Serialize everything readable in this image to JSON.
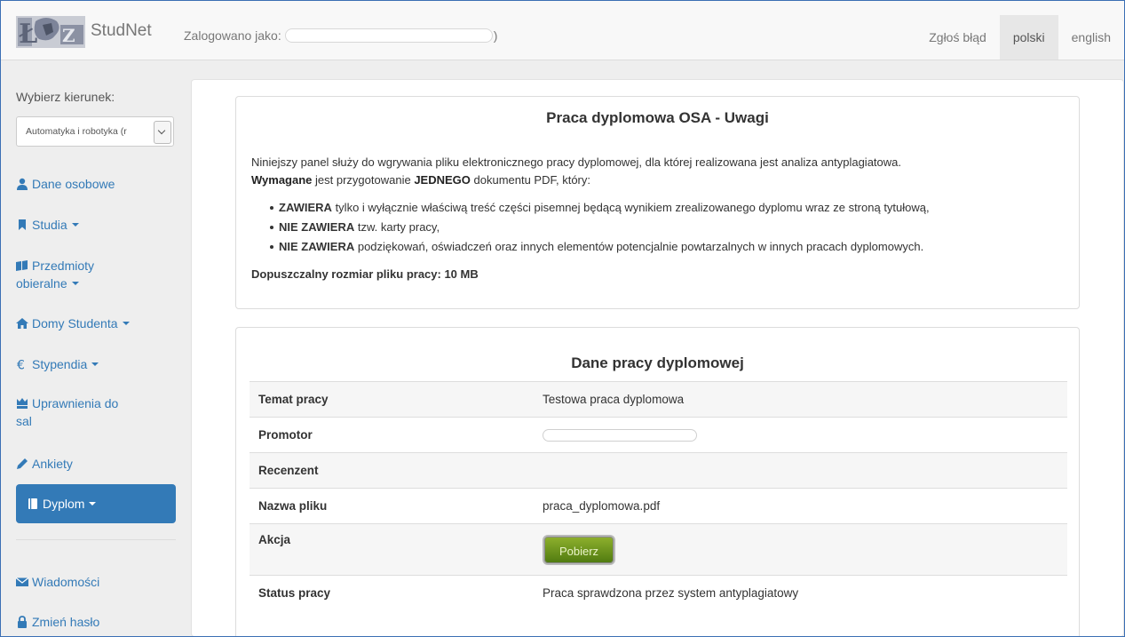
{
  "navbar": {
    "brand": "StudNet",
    "logged_as_label": "Zalogowano jako:",
    "paren": ")",
    "links": [
      "Zgłoś błąd",
      "polski",
      "english"
    ]
  },
  "sidebar": {
    "label": "Wybierz kierunek:",
    "select_value": "Automatyka i robotyka (r",
    "items": [
      {
        "label": "Dane osobowe",
        "icon": "user-icon"
      },
      {
        "label": "Studia",
        "icon": "bookmark-icon"
      },
      {
        "label": "Przedmioty",
        "label2": "obieralne",
        "icon": "book-open-icon"
      },
      {
        "label": "Domy Studenta",
        "icon": "home-icon"
      },
      {
        "label": "Stypendia",
        "icon": "euro-icon"
      },
      {
        "label": "Uprawnienia do",
        "label2": "sal",
        "icon": "throne-icon"
      },
      {
        "label": "Ankiety",
        "icon": "pencil-icon"
      },
      {
        "label": "Dyplom",
        "icon": "book-icon"
      },
      {
        "label": "Wiadomości",
        "icon": "envelope-icon"
      },
      {
        "label": "Zmień hasło",
        "icon": "lock-icon"
      }
    ]
  },
  "notes": {
    "title": "Praca dyplomowa OSA - Uwagi",
    "line1": "Niniejszy panel służy do wgrywania pliku elektronicznego pracy dyplomowej, dla której realizowana jest analiza antyplagiatowa.",
    "line2_b1": "Wymagane",
    "line2_t1": " jest przygotowanie ",
    "line2_b2": "JEDNEGO",
    "line2_t2": " dokumentu PDF, który:",
    "bullets": [
      {
        "bold": "ZAWIERA",
        "text": " tylko i wyłącznie właściwą treść części pisemnej będącą wynikiem zrealizowanego dyplomu wraz ze stroną tytułową,"
      },
      {
        "bold": "NIE ZAWIERA",
        "text": " tzw. karty pracy,"
      },
      {
        "bold": "NIE ZAWIERA",
        "text": " podziękowań, oświadczeń oraz innych elementów potencjalnie powtarzalnych w innych pracach dyplomowych."
      }
    ],
    "max_size": "Dopuszczalny rozmiar pliku pracy: 10 MB"
  },
  "thesis": {
    "title": "Dane pracy dyplomowej",
    "rows": [
      {
        "key": "Temat pracy",
        "value": "Testowa praca dyplomowa"
      },
      {
        "key": "Promotor",
        "value": ""
      },
      {
        "key": "Recenzent",
        "value": ""
      },
      {
        "key": "Nazwa pliku",
        "value": "praca_dyplomowa.pdf"
      },
      {
        "key": "Akcja",
        "value": ""
      },
      {
        "key": "Status pracy",
        "value": "Praca sprawdzona przez system antyplagiatowy"
      }
    ],
    "download_button": "Pobierz"
  },
  "colors": {
    "link": "#337ab7",
    "active_bg": "#337ab7",
    "status_red": "#e0201b",
    "button_green": "#6a9420"
  }
}
